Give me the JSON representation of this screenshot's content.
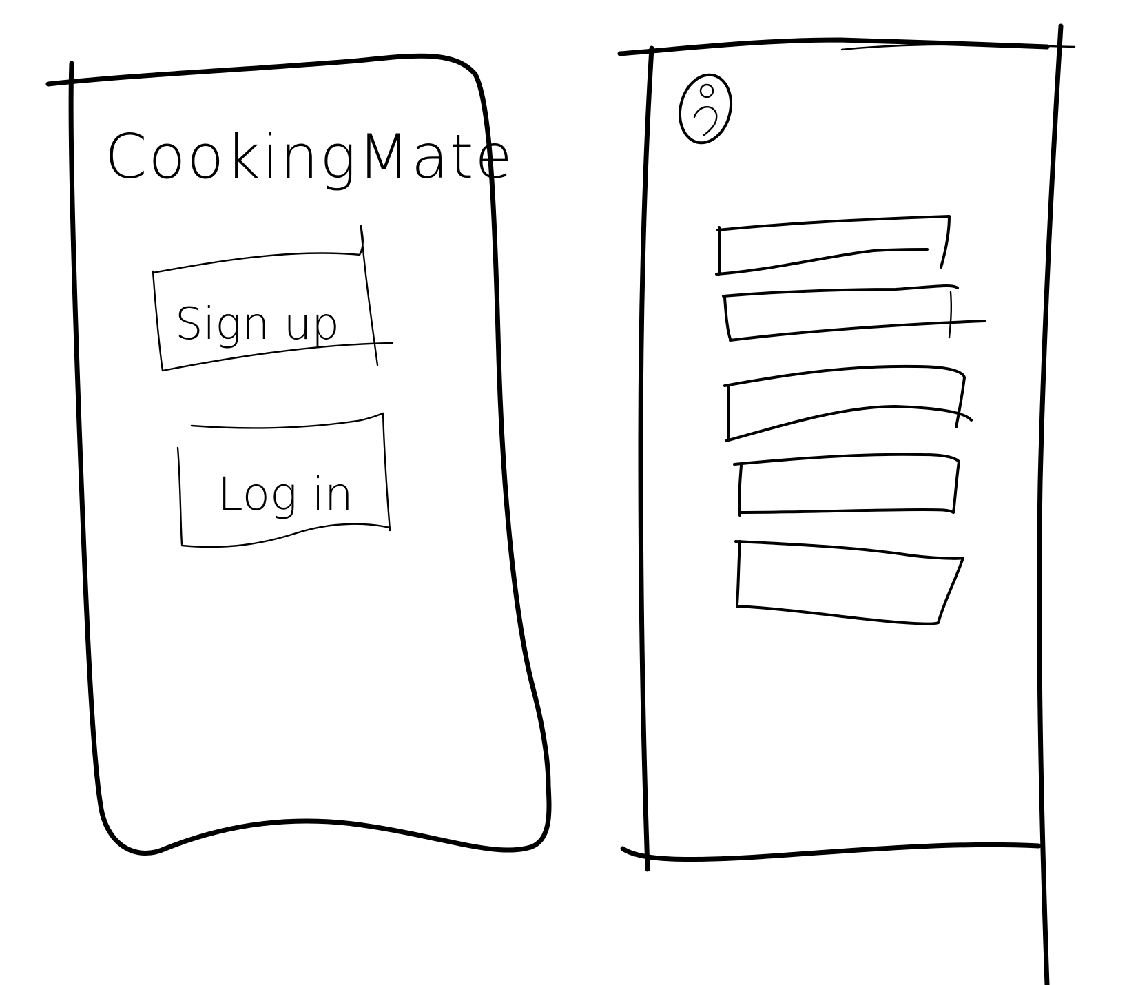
{
  "splash_screen": {
    "app_title": "CookingMate",
    "sign_up_label": "Sign up",
    "log_in_label": "Log in"
  },
  "list_screen": {
    "avatar_icon": "user-avatar-icon",
    "list_item_count_note": "",
    "list_items": [
      "",
      "",
      "",
      "",
      ""
    ]
  },
  "colors": {
    "ink": "#000000",
    "paper": "#ffffff"
  }
}
